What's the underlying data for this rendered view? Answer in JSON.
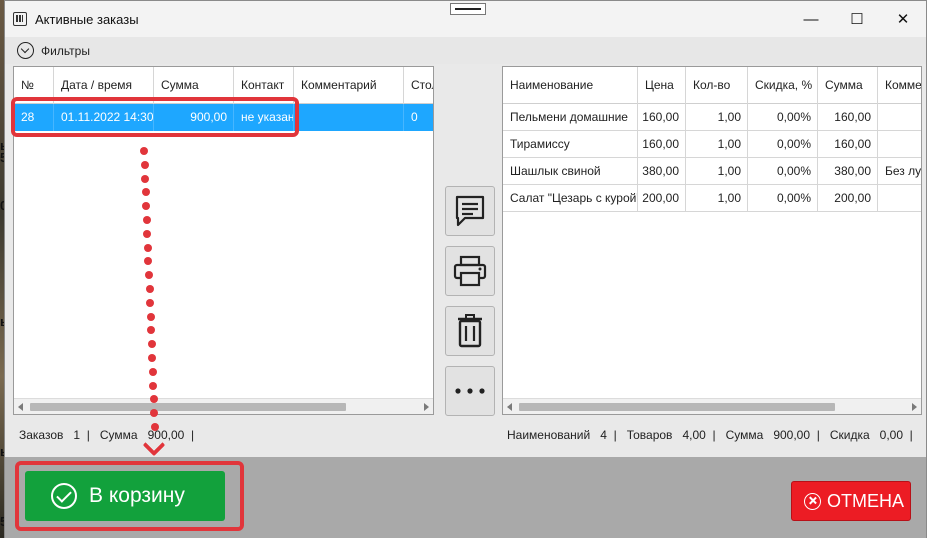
{
  "window": {
    "title": "Активные заказы",
    "minimize": "—",
    "maximize": "☐",
    "close": "✕"
  },
  "filters": {
    "label": "Фильтры"
  },
  "orders": {
    "columns": [
      "№",
      "Дата / время",
      "Сумма",
      "Контакт",
      "Комментарий",
      "Стол"
    ],
    "rows": [
      {
        "num": "28",
        "datetime": "01.11.2022 14:30",
        "sum": "900,00",
        "contact": "не указан",
        "comment": "",
        "table": "0"
      }
    ]
  },
  "items": {
    "columns": [
      "Наименование",
      "Цена",
      "Кол-во",
      "Скидка, %",
      "Сумма",
      "Комментарий"
    ],
    "rows": [
      {
        "name": "Пельмени домашние",
        "price": "160,00",
        "qty": "1,00",
        "discount": "0,00%",
        "sum": "160,00",
        "comment": ""
      },
      {
        "name": "Тирамиссу",
        "price": "160,00",
        "qty": "1,00",
        "discount": "0,00%",
        "sum": "160,00",
        "comment": ""
      },
      {
        "name": "Шашлык свиной",
        "price": "380,00",
        "qty": "1,00",
        "discount": "0,00%",
        "sum": "380,00",
        "comment": "Без лука"
      },
      {
        "name": "Салат \"Цезарь с курой\"",
        "price": "200,00",
        "qty": "1,00",
        "discount": "0,00%",
        "sum": "200,00",
        "comment": ""
      }
    ]
  },
  "status_left": {
    "orders_label": "Заказов",
    "orders_count": "1",
    "sum_label": "Сумма",
    "sum_value": "900,00"
  },
  "status_right": {
    "names_label": "Наименований",
    "names_value": "4",
    "goods_label": "Товаров",
    "goods_value": "4,00",
    "sum_label": "Сумма",
    "sum_value": "900,00",
    "discount_label": "Скидка",
    "discount_value": "0,00"
  },
  "side_buttons": [
    "comment-icon",
    "printer-icon",
    "trash-icon",
    "more-icon"
  ],
  "buttons": {
    "to_cart": "В корзину",
    "cancel": "ОТМЕНА"
  },
  "background_labels": [
    "ы",
    "5а",
    "0",
    "ы",
    "ы",
    "50"
  ],
  "colors": {
    "selected_row": "#1ea7ff",
    "cart_button": "#12a13c",
    "cancel_button": "#ec1c24",
    "annotation": "#e1353b"
  }
}
